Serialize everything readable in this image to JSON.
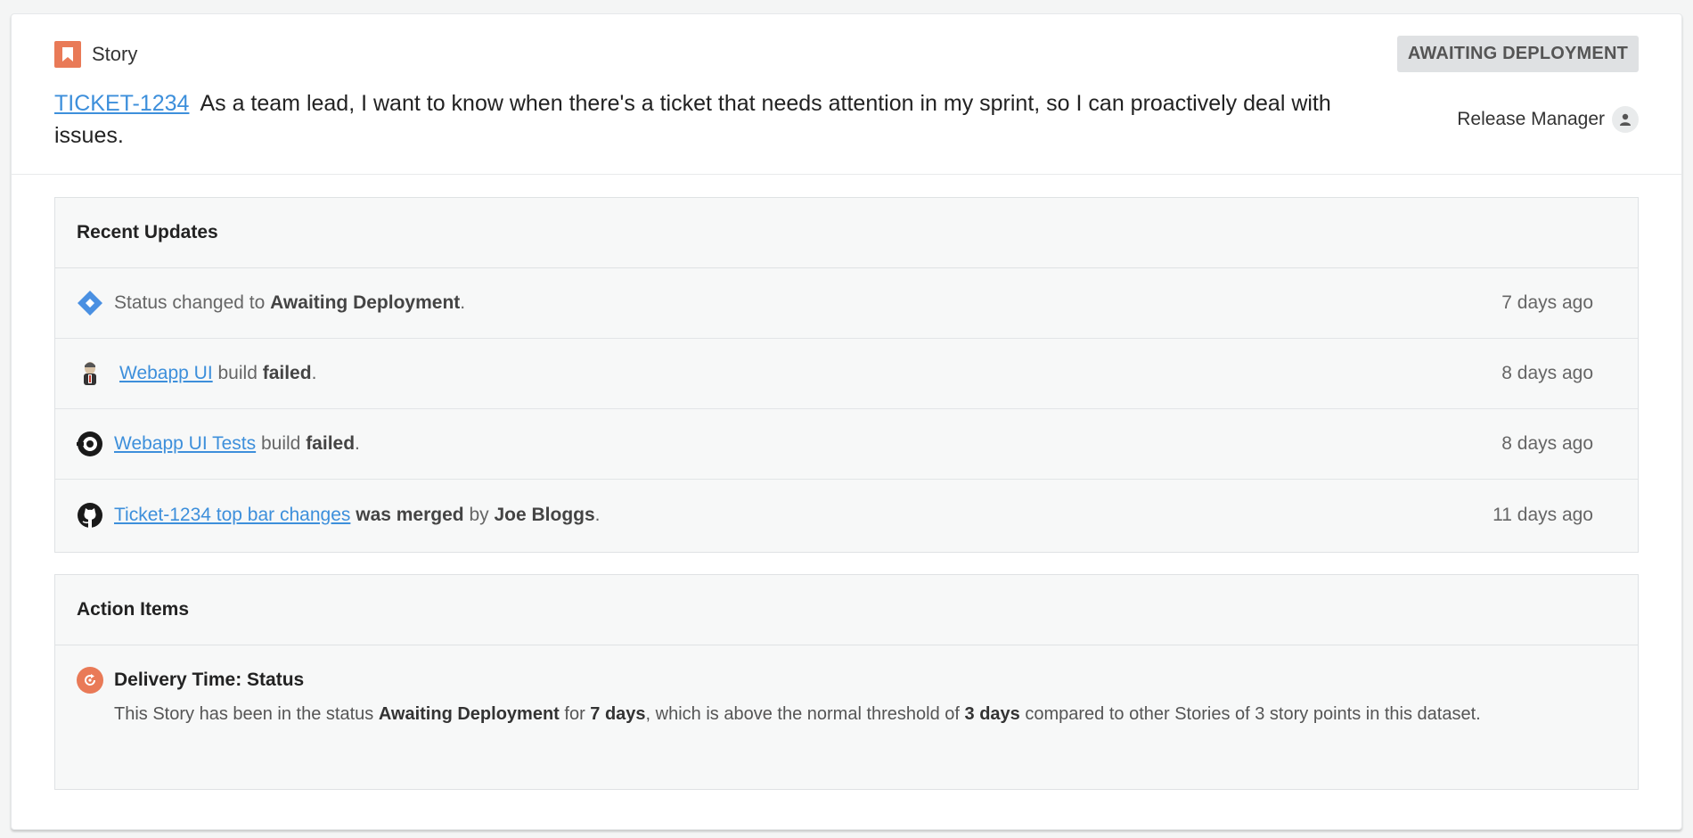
{
  "header": {
    "type_label": "Story",
    "status": "AWAITING DEPLOYMENT",
    "ticket_id": "TICKET-1234",
    "title": "As a team lead, I want to know when there's a ticket that needs attention in my sprint, so I can proactively deal with issues.",
    "assignee": "Release Manager"
  },
  "recent_updates": {
    "title": "Recent Updates",
    "rows": [
      {
        "icon": "jira-status-icon",
        "pre": "Status changed to ",
        "bold": "Awaiting Deployment",
        "post": ".",
        "time": "7 days ago"
      },
      {
        "icon": "jenkins-icon",
        "link": "Webapp UI",
        "mid": " build ",
        "bold": "failed",
        "post": ".",
        "time": "8 days ago"
      },
      {
        "icon": "circleci-icon",
        "link": "Webapp UI Tests",
        "mid": " build ",
        "bold": "failed",
        "post": ".",
        "time": "8 days ago"
      },
      {
        "icon": "github-icon",
        "link": "Ticket-1234 top bar changes",
        "mid": " ",
        "bold": "was merged",
        "mid2": " by ",
        "bold2": "Joe Bloggs",
        "post": ".",
        "time": "11 days ago"
      }
    ]
  },
  "action_items": {
    "title": "Action Items",
    "items": [
      {
        "title": "Delivery Time: Status",
        "d1": "This Story has been in the status ",
        "b1": "Awaiting Deployment",
        "d2": " for ",
        "b2": "7 days",
        "d3": ", which is above the normal threshold of ",
        "b3": "3 days",
        "d4": " compared to other Stories of 3 story points in this dataset."
      }
    ]
  },
  "colors": {
    "accent_orange": "#e97a57",
    "link_blue": "#3d8fdb",
    "badge_gray": "#dfe1e3"
  }
}
